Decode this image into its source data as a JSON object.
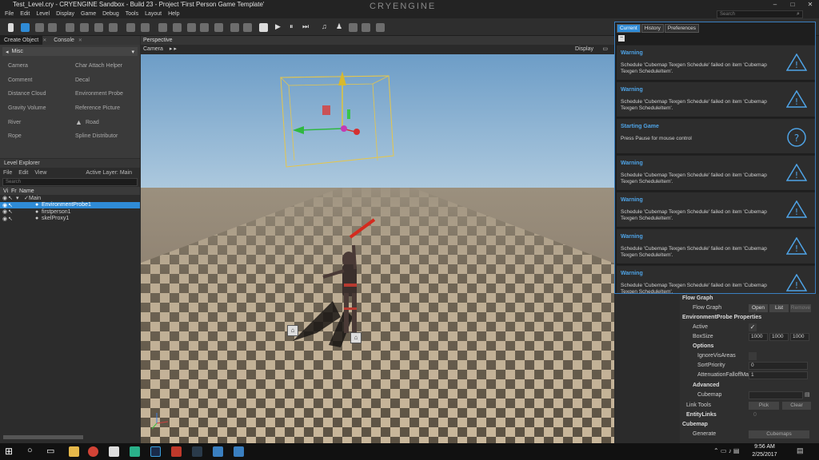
{
  "window": {
    "title": "Test_Level.cry - CRYENGINE Sandbox - Build 23 - Project 'First Person Game Template'",
    "brand": "CRYENGINE"
  },
  "menu": [
    "File",
    "Edit",
    "Level",
    "Display",
    "Game",
    "Debug",
    "Tools",
    "Layout",
    "Help"
  ],
  "search": {
    "placeholder": "Search"
  },
  "create_object": {
    "tabs": [
      "Create Object",
      "Console"
    ],
    "category": "Misc",
    "items": [
      "Camera",
      "Char Attach Helper",
      "Comment",
      "Decal",
      "Distance Cloud",
      "Environment Probe",
      "Gravity Volume",
      "Reference Picture",
      "River",
      "Road",
      "Rope",
      "Spline Distributor"
    ]
  },
  "level_explorer": {
    "title": "Level Explorer",
    "menu": [
      "File",
      "Edit",
      "View"
    ],
    "active_layer": "Active Layer: Main",
    "search_placeholder": "Search",
    "columns": [
      "Vi",
      "Fr",
      "Name"
    ],
    "rows": [
      {
        "name": "Main",
        "selected": false
      },
      {
        "name": "EnvironmentProbe1",
        "selected": true
      },
      {
        "name": "firstperson1",
        "selected": false
      },
      {
        "name": "skelProxy1",
        "selected": false
      }
    ]
  },
  "viewport": {
    "title": "Perspective",
    "camera_label": "Camera",
    "display_label": "Display"
  },
  "notifications": {
    "tabs": [
      "Current",
      "History",
      "Preferences"
    ],
    "items": [
      {
        "title": "Warning",
        "body": "Schedule 'Cubemap Texgen Schedule' failed on item 'Cubemap Texgen ScheduleItem'.",
        "icon": "warning-icon"
      },
      {
        "title": "Warning",
        "body": "Schedule 'Cubemap Texgen Schedule' failed on item 'Cubemap Texgen ScheduleItem'.",
        "icon": "warning-icon"
      },
      {
        "title": "Starting Game",
        "body": "Press Pause for mouse control",
        "icon": "help-icon"
      },
      {
        "title": "Warning",
        "body": "Schedule 'Cubemap Texgen Schedule' failed on item 'Cubemap Texgen ScheduleItem'.",
        "icon": "warning-icon"
      },
      {
        "title": "Warning",
        "body": "Schedule 'Cubemap Texgen Schedule' failed on item 'Cubemap Texgen ScheduleItem'.",
        "icon": "warning-icon"
      },
      {
        "title": "Warning",
        "body": "Schedule 'Cubemap Texgen Schedule' failed on item 'Cubemap Texgen ScheduleItem'.",
        "icon": "warning-icon"
      },
      {
        "title": "Warning",
        "body": "Schedule 'Cubemap Texgen Schedule' failed on item 'Cubemap Texgen ScheduleItem'.",
        "icon": "warning-icon"
      }
    ]
  },
  "properties": {
    "flow_graph": "Flow Graph",
    "flow_graph_label": "Flow Graph",
    "open": "Open",
    "list": "List",
    "remove": "Remove",
    "probe_props": "EnvironmentProbe Properties",
    "active": "Active",
    "box_size": "BoxSize",
    "box_values": [
      "1000",
      "1000",
      "1000"
    ],
    "options": "Options",
    "ignore_vis": "IgnoreVisAreas",
    "sort_priority": "SortPriority",
    "sort_value": "0",
    "attenuation": "AttenuationFalloffMa",
    "attenuation_value": "1",
    "advanced": "Advanced",
    "cubemap": "Cubemap",
    "link_tools": "Link Tools",
    "pick": "Pick",
    "clear": "Clear",
    "entity_links": "EntityLinks",
    "entity_links_value": "0",
    "cubemap_section": "Cubemap",
    "generate": "Generate",
    "cubemaps_btn": "Cubemaps"
  },
  "taskbar": {
    "time": "9:56 AM",
    "date": "2/25/2017"
  },
  "colors": {
    "accent": "#2f8bd6",
    "warning_text": "#4ea3e6"
  }
}
